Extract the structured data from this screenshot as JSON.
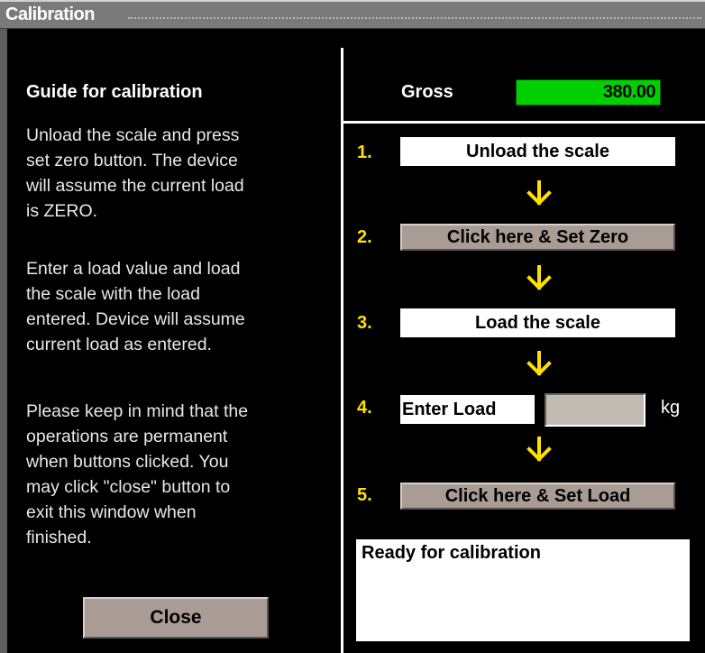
{
  "window": {
    "title": "Calibration"
  },
  "guide": {
    "title": "Guide for calibration",
    "para1": [
      "Unload the scale and press",
      "set zero button. The device",
      "will assume the current load",
      "is ZERO."
    ],
    "para2": [
      "Enter a load value and load",
      "the scale with the load",
      "entered. Device will assume",
      "current load as entered."
    ],
    "para3": [
      "Please keep in mind that the",
      "operations are permanent",
      "when buttons clicked. You",
      "may click \"close\" button to",
      "exit this window when",
      "finished."
    ],
    "close_label": "Close"
  },
  "gross": {
    "label": "Gross",
    "value": "380.00"
  },
  "steps": [
    {
      "num": "1.",
      "label": "Unload the scale"
    },
    {
      "num": "2.",
      "label": "Click here & Set Zero"
    },
    {
      "num": "3.",
      "label": "Load the scale"
    },
    {
      "num": "4.",
      "label": "Enter Load",
      "input_value": "",
      "unit": "kg"
    },
    {
      "num": "5.",
      "label": "Click here & Set Load"
    }
  ],
  "status": {
    "text": "Ready for calibration"
  },
  "colors": {
    "accent_arrow": "#ffe000",
    "gross_bg": "#00d000",
    "button_bg": "#a89c95"
  }
}
